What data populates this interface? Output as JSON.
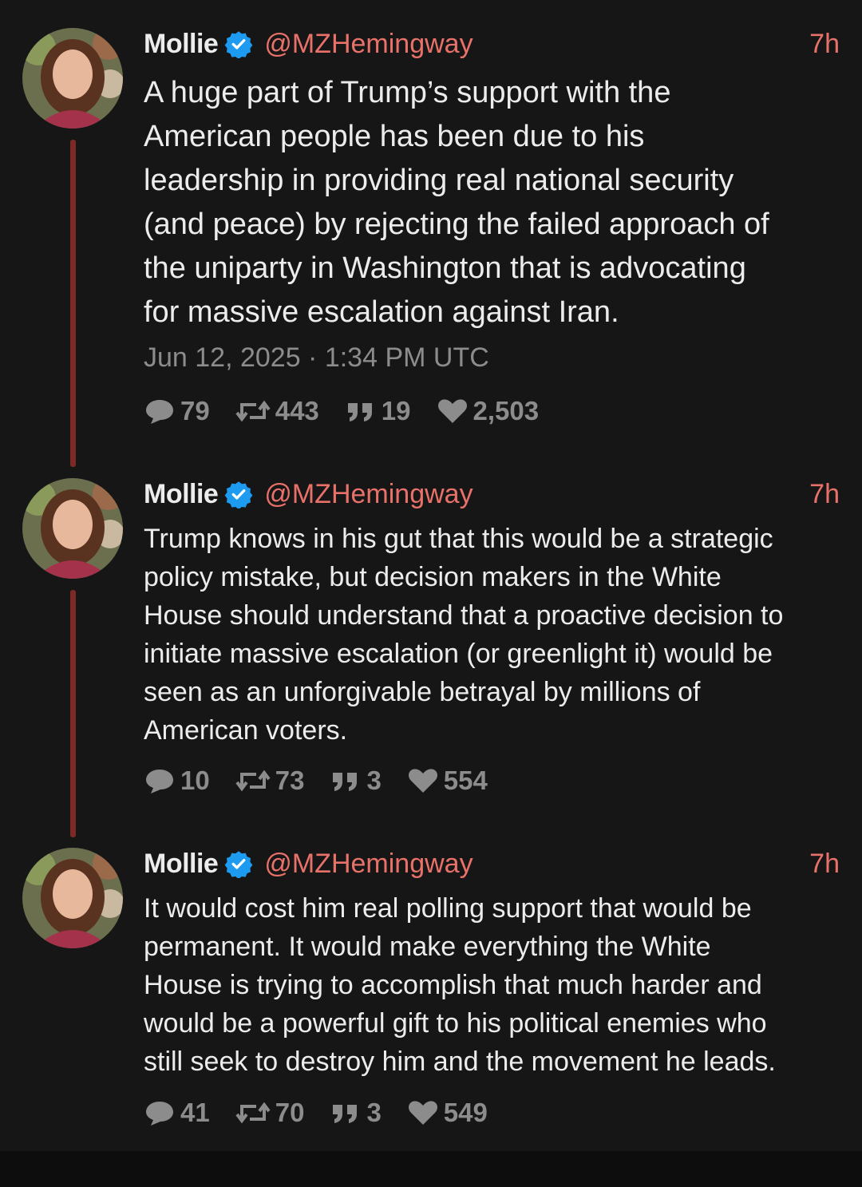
{
  "colors": {
    "background": "#161616",
    "accent": "#e8716a",
    "thread_line": "#7d2a24",
    "verified": "#1d9bf0",
    "text": "#ececec",
    "muted": "#8c8c8c"
  },
  "tweets": [
    {
      "name": "Mollie",
      "handle": "@MZHemingway",
      "age": "7h",
      "text": "A huge part of Trump’s support with the\nAmerican people has been due to his\nleadership in providing real national security\n(and peace) by rejecting the failed approach of\nthe uniparty in Washington that is advocating\nfor massive escalation against Iran.",
      "timestamp": "Jun 12, 2025 · 1:34 PM UTC",
      "replies": "79",
      "retweets": "443",
      "quotes": "19",
      "likes": "2,503"
    },
    {
      "name": "Mollie",
      "handle": "@MZHemingway",
      "age": "7h",
      "text": "Trump knows in his gut that this would be a strategic\npolicy mistake, but decision makers in the White\nHouse should understand that a proactive decision to\ninitiate massive escalation (or greenlight it) would be\nseen as an unforgivable betrayal by millions of\nAmerican voters.",
      "replies": "10",
      "retweets": "73",
      "quotes": "3",
      "likes": "554"
    },
    {
      "name": "Mollie",
      "handle": "@MZHemingway",
      "age": "7h",
      "text": "It would cost him real polling support that would be\npermanent. It would make everything the White\nHouse is trying to accomplish that much harder and\nwould be a powerful gift to his political enemies who\nstill seek to destroy him and the movement he leads.",
      "replies": "41",
      "retweets": "70",
      "quotes": "3",
      "likes": "549"
    }
  ],
  "icons": {
    "avatar": "avatar",
    "verified": "verified-badge-icon",
    "reply": "reply-bubble-icon",
    "retweet": "retweet-icon",
    "quote": "quote-icon",
    "like": "heart-icon"
  }
}
